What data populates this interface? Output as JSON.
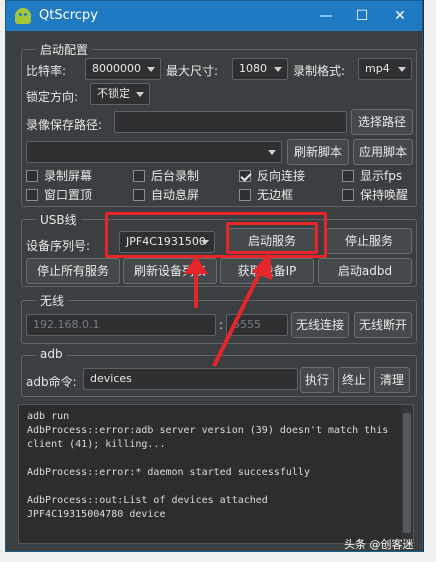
{
  "window": {
    "title": "QtScrcpy",
    "minimize": "—",
    "maximize": "☐",
    "close": "✕"
  },
  "start_config": {
    "group_title": "启动配置",
    "bitrate_label": "比特率:",
    "bitrate_value": "8000000",
    "max_size_label": "最大尺寸:",
    "max_size_value": "1080",
    "record_format_label": "录制格式:",
    "record_format_value": "mp4",
    "lock_orientation_label": "锁定方向:",
    "lock_orientation_value": "不锁定",
    "record_path_label": "录像保存路径:",
    "record_path_value": "",
    "select_path_button": "选择路径",
    "script_combo_value": "",
    "refresh_script_button": "刷新脚本",
    "apply_script_button": "应用脚本",
    "checkboxes": [
      {
        "label": "录制屏幕",
        "checked": false
      },
      {
        "label": "后台录制",
        "checked": false
      },
      {
        "label": "反向连接",
        "checked": true
      },
      {
        "label": "显示fps",
        "checked": false
      },
      {
        "label": "窗口置顶",
        "checked": false
      },
      {
        "label": "自动息屏",
        "checked": false
      },
      {
        "label": "无边框",
        "checked": false
      },
      {
        "label": "保持唤醒",
        "checked": false
      }
    ]
  },
  "usb": {
    "group_title": "USB线",
    "serial_label": "设备序列号:",
    "serial_value": "JPF4C1931500",
    "start_service_button": "启动服务",
    "stop_service_button": "停止服务",
    "stop_all_button": "停止所有服务",
    "refresh_devices_button": "刷新设备列表",
    "get_ip_button": "获取设备IP",
    "start_adbd_button": "启动adbd"
  },
  "wireless": {
    "group_title": "无线",
    "ip_value": "192.168.0.1",
    "separator": ":",
    "port_value": "5555",
    "connect_button": "无线连接",
    "disconnect_button": "无线断开"
  },
  "adb": {
    "group_title": "adb",
    "command_label": "adb命令:",
    "command_value": "devices",
    "execute_button": "执行",
    "stop_button": "终止",
    "clear_button": "清理"
  },
  "console": {
    "lines": [
      "adb run",
      "AdbProcess::error:adb server version (39) doesn't match this",
      "client (41); killing...",
      "",
      "AdbProcess::error:* daemon started successfully",
      "",
      "AdbProcess::out:List of devices attached",
      "JPF4C19315004780           device"
    ]
  },
  "watermark": "头条 @创客迷",
  "colors": {
    "titlebar": "#1f7ac4",
    "highlight": "#e6262b",
    "panel": "#3c3f41"
  }
}
